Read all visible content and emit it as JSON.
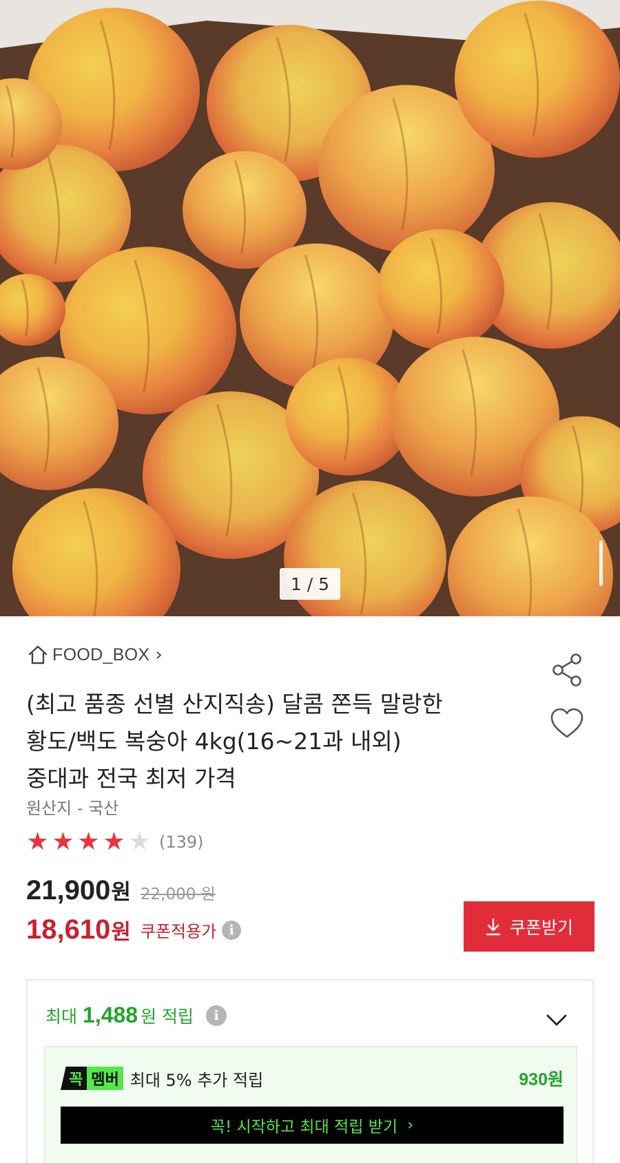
{
  "gallery": {
    "image_alt": "Box of ripe yellow peaches",
    "current_page": 1,
    "total_pages": 5,
    "indicator_text": "1 / 5"
  },
  "store": {
    "icon": "home-icon",
    "name": "FOOD_BOX",
    "chevron": "›"
  },
  "actions": {
    "share_icon": "share-icon",
    "like_icon": "heart-icon"
  },
  "product": {
    "title_lines": [
      "(최고 품종 선별 산지직송) 달콤 쫀득 말랑한",
      "황도/백도 복숭아 4kg(16~21과 내외)",
      "중대과 전국 최저 가격"
    ],
    "origin": "원산지 - 국산",
    "rating": 4,
    "rating_max": 5,
    "review_count": "(139)"
  },
  "pricing": {
    "price": "21,900",
    "currency": "원",
    "original_price": "22,000 원",
    "coupon_price": "18,610",
    "coupon_label": "쿠폰적용가",
    "coupon_button": "쿠폰받기"
  },
  "points": {
    "prefix": "최대",
    "amount": "1,488",
    "suffix": "원 적립",
    "member_badge_left": "꼭",
    "member_badge_right": "멤버",
    "member_text": "최대 5% 추가 적립",
    "member_amount": "930원",
    "member_cta": "꼭! 시작하고 최대 적립 받기",
    "member_cta_arrow": "›"
  },
  "colors": {
    "accent_red": "#e12d3a",
    "price_red": "#c9202e",
    "points_green": "#22a52a",
    "member_green": "#56e84a",
    "star_on": "#e9343f",
    "star_off": "#dcdcdc"
  }
}
